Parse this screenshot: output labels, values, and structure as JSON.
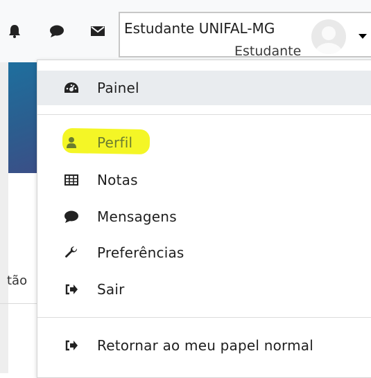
{
  "navbar": {
    "icons": [
      "bell-icon",
      "chat-bubble-icon",
      "envelope-icon"
    ],
    "user_name": "Estudante UNIFAL-MG",
    "user_role": "Estudante"
  },
  "background": {
    "left_text": "tão"
  },
  "menu": {
    "items": [
      {
        "label": "Painel",
        "icon": "dashboard-icon"
      },
      {
        "label": "Perfil",
        "icon": "user-icon"
      },
      {
        "label": "Notas",
        "icon": "table-icon"
      },
      {
        "label": "Mensagens",
        "icon": "chat-bubble-icon"
      },
      {
        "label": "Preferências",
        "icon": "wrench-icon"
      },
      {
        "label": "Sair",
        "icon": "sign-out-icon"
      },
      {
        "label": "Retornar ao meu papel normal",
        "icon": "sign-out-icon"
      }
    ]
  },
  "colors": {
    "highlight": "#f3f51a",
    "perfil_text": "#6b7d2f",
    "accent_blue": "#1c7fc9"
  }
}
